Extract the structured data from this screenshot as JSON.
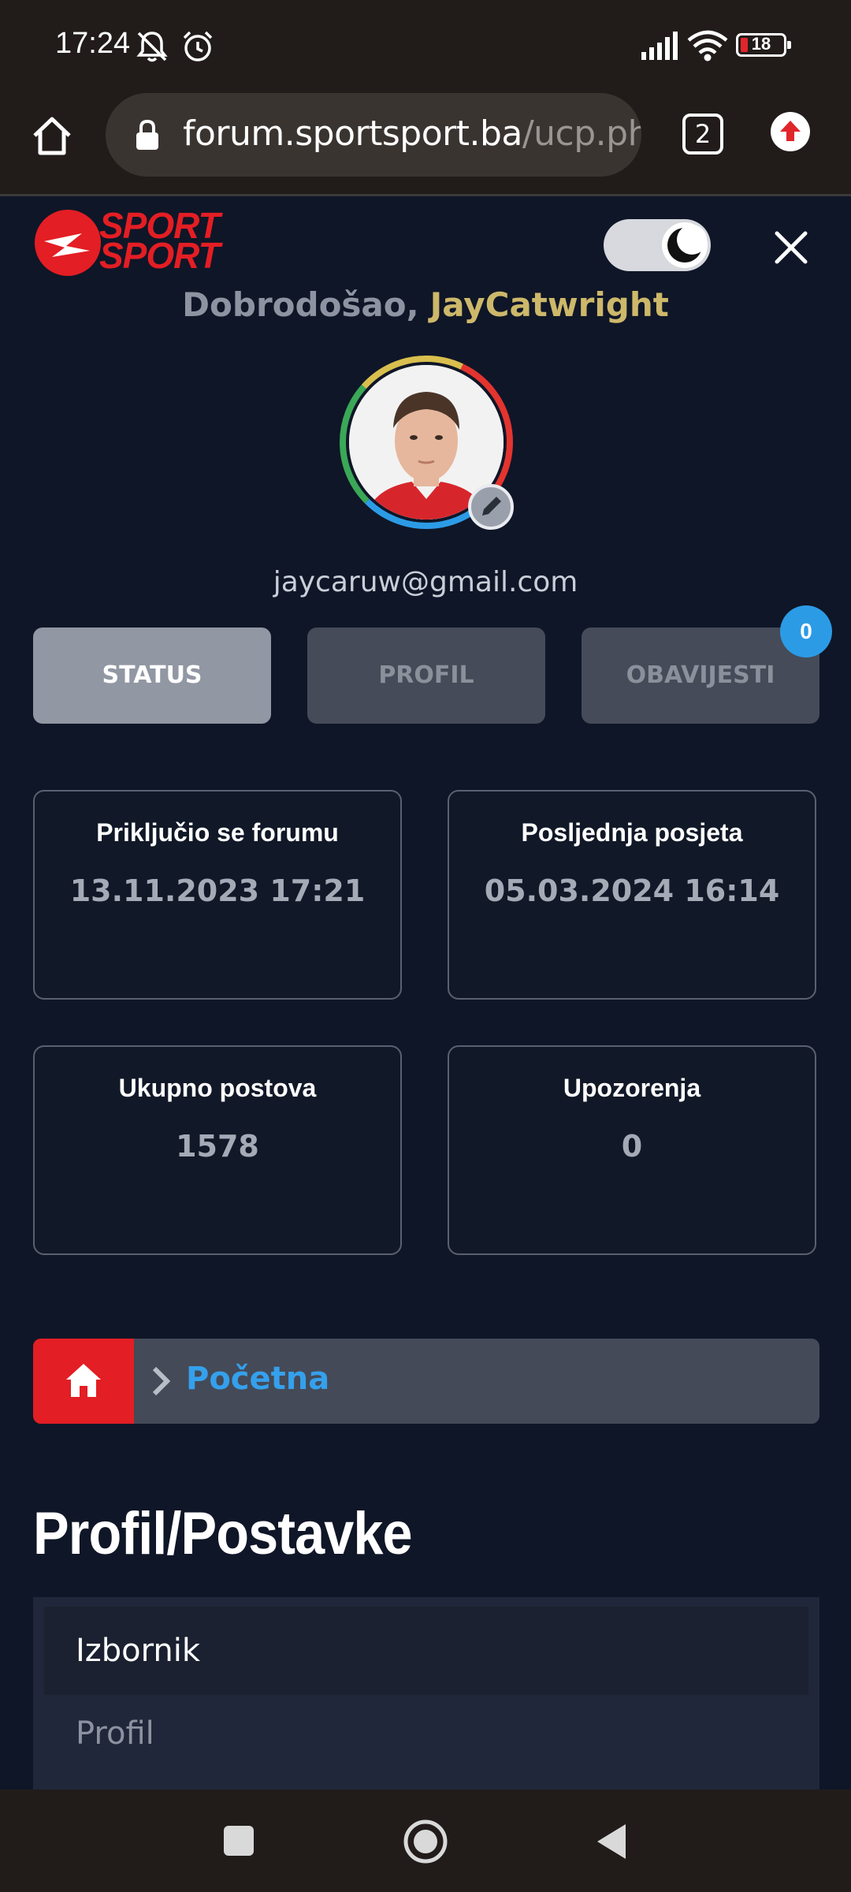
{
  "status_bar": {
    "time": "17:24",
    "battery_level": "18",
    "battery_fraction": 0.18,
    "icons": [
      "notifications-off-icon",
      "alarm-icon",
      "signal-icon",
      "wifi-icon",
      "battery-icon"
    ]
  },
  "browser": {
    "url_host": "forum.sportsport.ba",
    "url_path": "/ucp.php",
    "tab_count": "2",
    "icons": [
      "home-icon",
      "lock-icon",
      "tabs-icon",
      "update-icon"
    ]
  },
  "header": {
    "logo_line1": "SPORT",
    "logo_line2": "SPORT",
    "theme_mode": "dark",
    "greeting": "Dobrodošao,",
    "username": "JayCatwright",
    "email": "jaycaruw@gmail.com"
  },
  "tabs": [
    {
      "label": "STATUS",
      "active": true
    },
    {
      "label": "PROFIL",
      "active": false
    },
    {
      "label": "OBAVIJESTI",
      "active": false
    }
  ],
  "notifications_count": "0",
  "stats": [
    {
      "label": "Priključio se forumu",
      "value": "13.11.2023 17:21"
    },
    {
      "label": "Posljednja posjeta",
      "value": "05.03.2024 16:14"
    },
    {
      "label": "Ukupno postova",
      "value": "1578"
    },
    {
      "label": "Upozorenja",
      "value": "0"
    }
  ],
  "breadcrumb": {
    "label": "Početna"
  },
  "page_title": "Profil/Postavke",
  "menu": {
    "title": "Izbornik",
    "items": [
      "Profil"
    ]
  },
  "colors": {
    "background": "#0f1627",
    "brand_red": "#e31e24",
    "username_gold": "#cdb86a",
    "link_blue": "#35a0ec",
    "badge_blue": "#2c9be6"
  }
}
